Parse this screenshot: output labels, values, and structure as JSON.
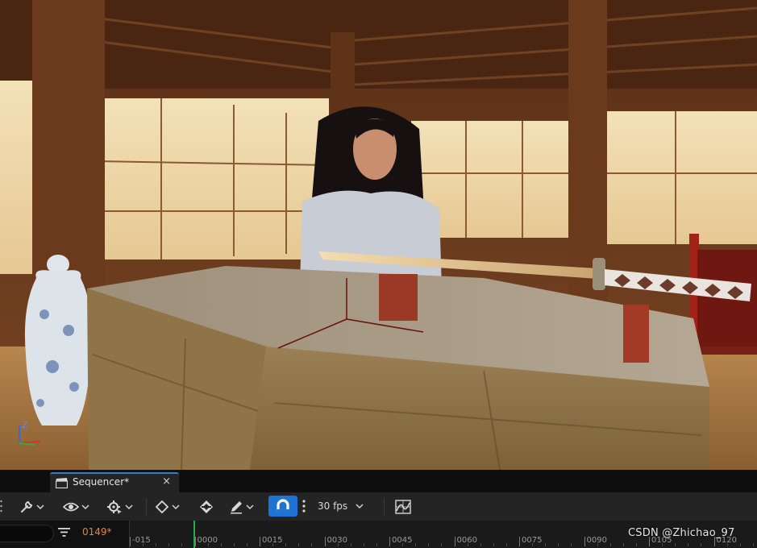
{
  "viewport": {
    "description_icon": "perspective-viewport-3d-scene",
    "axis_label": "Z"
  },
  "sequencer": {
    "tab_label": "Sequencer*",
    "close_glyph": "×",
    "fps_label": "30 fps",
    "current_frame": "0149*",
    "ruler_labels": [
      "-015",
      "0000",
      "0015",
      "0030",
      "0045",
      "0060",
      "0075",
      "0090",
      "0105",
      "0120"
    ],
    "playhead_frame": "0000",
    "icons": {
      "tab": "clapperboard-icon",
      "tools": "wrench-icon",
      "view": "eye-icon",
      "transform": "gear-transform-icon",
      "key": "keyframe-diamond-icon",
      "fill": "paint-bucket-icon",
      "pen": "pen-icon",
      "snap": "magnet-icon",
      "curves": "curve-editor-icon",
      "filter": "filter-icon"
    },
    "colors": {
      "accent": "#1e74d6",
      "current_frame": "#e08a1e",
      "playhead": "#1fb14a"
    }
  },
  "watermark": "CSDN @Zhichao_97"
}
